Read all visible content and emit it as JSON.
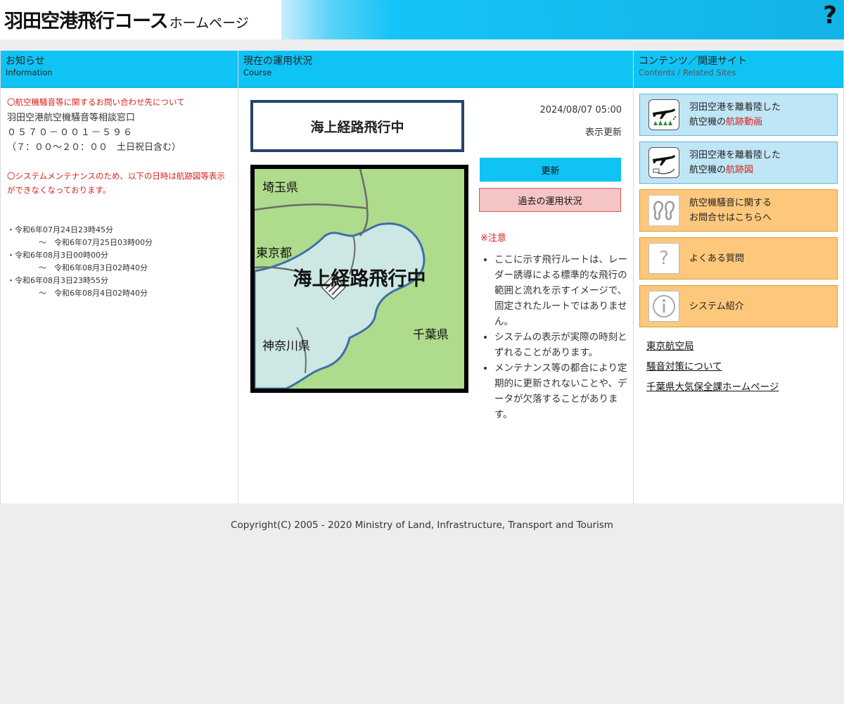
{
  "header": {
    "title_main": "羽田空港飛行コース",
    "title_sub": "ホームページ",
    "help_symbol": "?"
  },
  "info": {
    "heading": "お知らせ",
    "heading_en": "Information",
    "contact_notice": "〇航空機騒音等に関するお問い合わせ先について",
    "contact_name": "羽田空港航空機騒音等相談窓口",
    "contact_phone": "０５７０－００１－５９６",
    "contact_hours": "（７：００～２０：００　土日祝日含む）",
    "maintenance_notice": "〇システムメンテナンスのため、以下の日時は航跡図等表示ができなくなっております。",
    "maintenance_dates": [
      {
        "from": "・令和6年07月24日23時45分",
        "to": "～　令和6年07月25日03時00分"
      },
      {
        "from": "・令和6年08月3日00時00分",
        "to": "～　令和6年08月3日02時40分"
      },
      {
        "from": "・令和6年08月3日23時55分",
        "to": "～　令和6年08月4日02時40分"
      }
    ]
  },
  "course": {
    "heading": "現在の運用状況",
    "heading_en": "Course",
    "status": "海上経路飛行中",
    "map_overlay": "海上経路飛行中",
    "map_labels": {
      "saitama": "埼玉県",
      "tokyo": "東京都",
      "kanagawa": "神奈川県",
      "chiba": "千葉県"
    },
    "datetime": "2024/08/07 05:00",
    "refresh_text": "表示更新",
    "update_button": "更新",
    "past_button": "過去の運用状況",
    "notice_title": "※注意",
    "notes": [
      "ここに示す飛行ルートは、レーダー誘導による標準的な飛行の範囲と流れを示すイメージで、固定されたルートではありません。",
      "システムの表示が実際の時刻とずれることがあります。",
      "メンテナンス等の都合により定期的に更新されないことや、データが欠落することがあります。"
    ]
  },
  "links": {
    "heading": "コンテンツ／関連サイト",
    "heading_en": "Contents / Related Sites",
    "tiles": [
      {
        "line1": "羽田空港を離着陸した",
        "line2_prefix": "航空機の",
        "line2_highlight": "航跡動画",
        "icon": "airplane-video-icon"
      },
      {
        "line1": "羽田空港を離着陸した",
        "line2_prefix": "航空機の",
        "line2_highlight": "航跡図",
        "icon": "airplane-track-icon"
      },
      {
        "line1": "航空機騒音に関する",
        "line2_prefix": "お問合せはこちらへ",
        "line2_highlight": "",
        "icon": "ear-icon"
      },
      {
        "line1": "よくある質問",
        "icon": "question-icon"
      },
      {
        "line1": "システム紹介",
        "icon": "info-icon"
      }
    ],
    "site_links": [
      "東京航空局",
      "騒音対策について",
      "千葉県大気保全課ホームページ"
    ]
  },
  "footer": {
    "copyright": "Copyright(C) 2005 - 2020 Ministry of Land, Infrastructure, Transport and Tourism"
  },
  "colors": {
    "accent": "#0fc3f5",
    "notice_red": "#d6221b",
    "tile_blue": "#bfe6f5",
    "tile_orange": "#fdc87c",
    "map_land": "#aedb8c",
    "map_water": "#cde8e4"
  }
}
